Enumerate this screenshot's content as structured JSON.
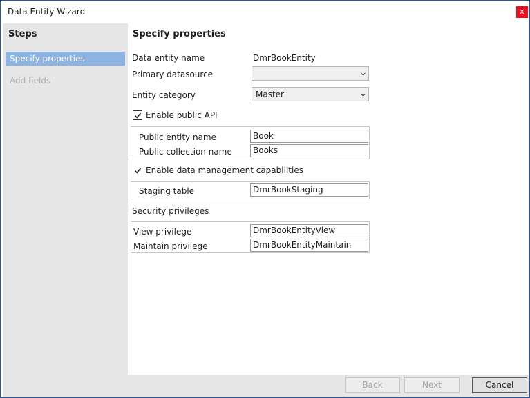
{
  "window": {
    "title": "Data Entity Wizard",
    "close_glyph": "x"
  },
  "sidebar": {
    "heading": "Steps",
    "steps": [
      {
        "label": "Specify properties",
        "state": "active"
      },
      {
        "label": "Add fields",
        "state": "disabled"
      }
    ]
  },
  "main": {
    "title": "Specify properties",
    "data_entity_name": {
      "label": "Data entity name",
      "value": "DmrBookEntity"
    },
    "primary_datasource": {
      "label": "Primary datasource",
      "value": ""
    },
    "entity_category": {
      "label": "Entity category",
      "value": "Master"
    },
    "enable_public_api": {
      "label": "Enable public API",
      "checked": true
    },
    "public_entity_name": {
      "label": "Public entity name",
      "value": "Book"
    },
    "public_collection_name": {
      "label": "Public collection name",
      "value": "Books"
    },
    "enable_data_management": {
      "label": "Enable data management capabilities",
      "checked": true
    },
    "staging_table": {
      "label": "Staging table",
      "value": "DmrBookStaging"
    },
    "security_privileges_label": "Security privileges",
    "view_privilege": {
      "label": "View privilege",
      "value": "DmrBookEntityView"
    },
    "maintain_privilege": {
      "label": "Maintain privilege",
      "value": "DmrBookEntityMaintain"
    }
  },
  "footer": {
    "back_label": "Back",
    "next_label": "Next",
    "cancel_label": "Cancel"
  },
  "colors": {
    "accent": "#8db3e2",
    "close": "#e81123",
    "sidebar_bg": "#e6e6e6"
  },
  "icons": {
    "close": "close-icon",
    "dropdown": "chevron-down-icon",
    "checkbox": "checkmark-icon"
  }
}
